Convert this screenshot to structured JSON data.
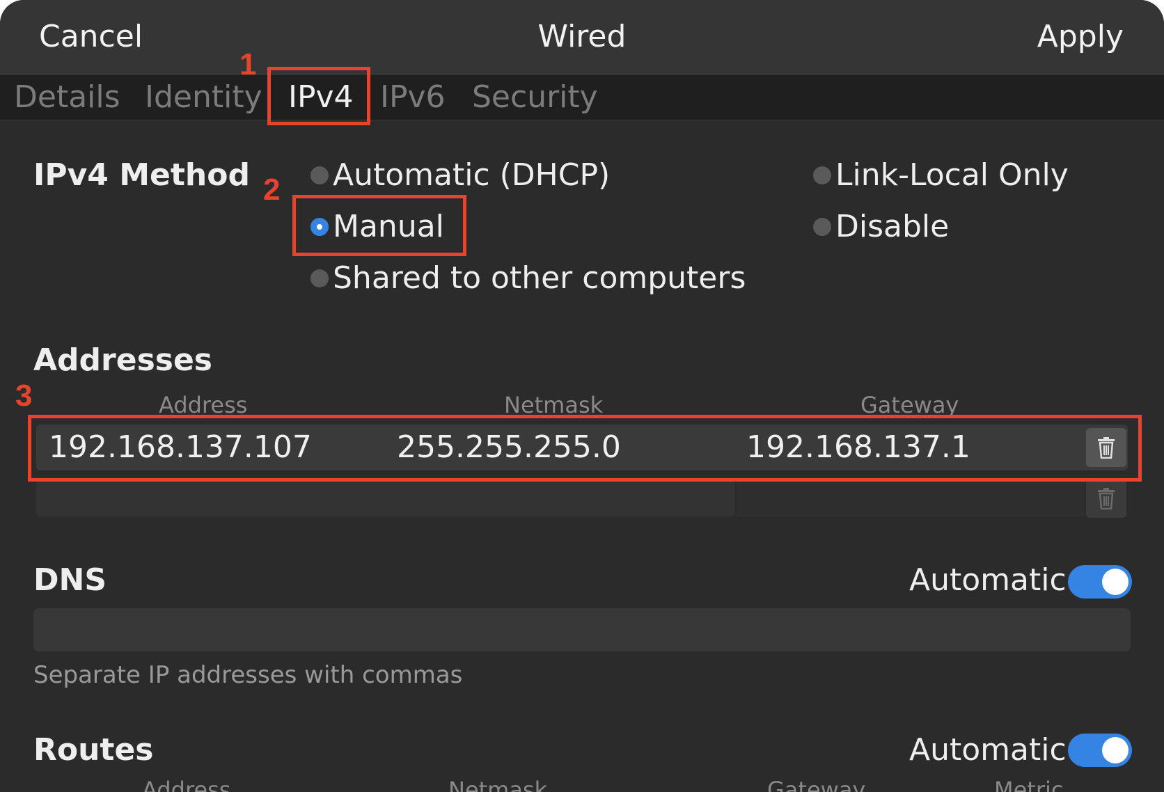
{
  "header": {
    "cancel_label": "Cancel",
    "title": "Wired",
    "apply_label": "Apply"
  },
  "tabs": [
    {
      "label": "Details",
      "active": false
    },
    {
      "label": "Identity",
      "active": false
    },
    {
      "label": "IPv4",
      "active": true
    },
    {
      "label": "IPv6",
      "active": false
    },
    {
      "label": "Security",
      "active": false
    }
  ],
  "ipv4_method": {
    "title": "IPv4 Method",
    "options": [
      {
        "label": "Automatic (DHCP)",
        "checked": false
      },
      {
        "label": "Manual",
        "checked": true
      },
      {
        "label": "Shared to other computers",
        "checked": false
      },
      {
        "label": "Link-Local Only",
        "checked": false
      },
      {
        "label": "Disable",
        "checked": false
      }
    ]
  },
  "addresses": {
    "title": "Addresses",
    "columns": [
      "Address",
      "Netmask",
      "Gateway"
    ],
    "rows": [
      {
        "address": "192.168.137.107",
        "netmask": "255.255.255.0",
        "gateway": "192.168.137.1"
      }
    ]
  },
  "dns": {
    "title": "DNS",
    "automatic_label": "Automatic",
    "automatic_on": true,
    "value": "",
    "hint": "Separate IP addresses with commas"
  },
  "routes": {
    "title": "Routes",
    "automatic_label": "Automatic",
    "automatic_on": true,
    "columns": [
      "Address",
      "Netmask",
      "Gateway",
      "Metric"
    ]
  },
  "annotations": [
    "1",
    "2",
    "3"
  ],
  "colors": {
    "accent": "#3584e4",
    "annotation": "#e8432c",
    "background": "#2b2b2b"
  }
}
